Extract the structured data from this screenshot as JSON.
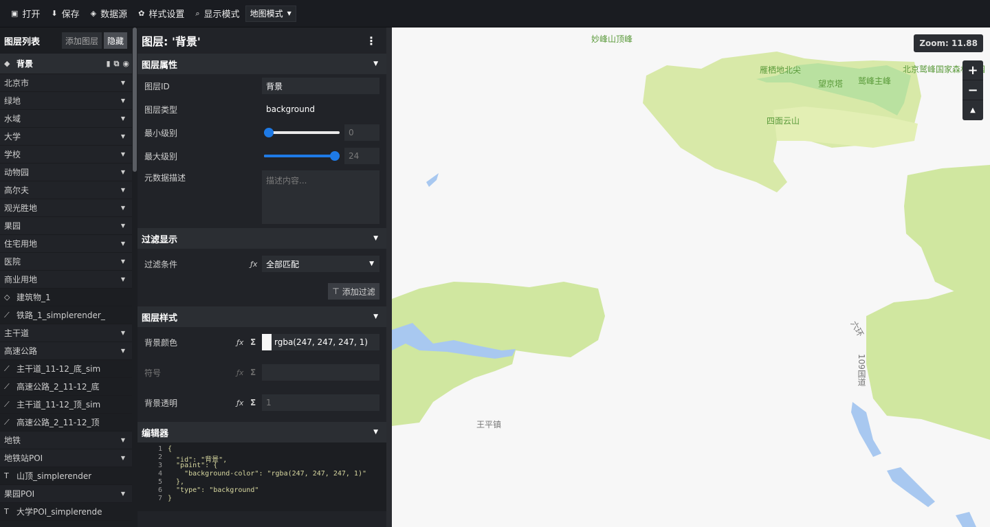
{
  "toolbar": {
    "open": "打开",
    "save": "保存",
    "datasource": "数据源",
    "style_settings": "样式设置",
    "display_mode": "显示模式",
    "mode_value": "地图模式"
  },
  "layer_panel": {
    "title": "图层列表",
    "add_layer": "添加图层",
    "hide": "隐藏",
    "selected": "背景",
    "items": [
      {
        "label": "北京市",
        "kind": "group"
      },
      {
        "label": "绿地",
        "kind": "group"
      },
      {
        "label": "水域",
        "kind": "group"
      },
      {
        "label": "大学",
        "kind": "group"
      },
      {
        "label": "学校",
        "kind": "group"
      },
      {
        "label": "动物园",
        "kind": "group"
      },
      {
        "label": "高尔夫",
        "kind": "group"
      },
      {
        "label": "观光胜地",
        "kind": "group"
      },
      {
        "label": "果园",
        "kind": "group"
      },
      {
        "label": "住宅用地",
        "kind": "group"
      },
      {
        "label": "医院",
        "kind": "group"
      },
      {
        "label": "商业用地",
        "kind": "group"
      },
      {
        "label": "建筑物_1",
        "kind": "fill"
      },
      {
        "label": "铁路_1_simplerender_",
        "kind": "line"
      },
      {
        "label": "主干道",
        "kind": "group"
      },
      {
        "label": "高速公路",
        "kind": "group"
      },
      {
        "label": "主干道_11-12_底_sim",
        "kind": "line"
      },
      {
        "label": "高速公路_2_11-12_底",
        "kind": "line"
      },
      {
        "label": "主干道_11-12_顶_sim",
        "kind": "line"
      },
      {
        "label": "高速公路_2_11-12_顶",
        "kind": "line"
      },
      {
        "label": "地铁",
        "kind": "group"
      },
      {
        "label": "地铁站POI",
        "kind": "group"
      },
      {
        "label": "山顶_simplerender",
        "kind": "symbol"
      },
      {
        "label": "果园POI",
        "kind": "group"
      },
      {
        "label": "大学POI_simplerende",
        "kind": "symbol"
      }
    ]
  },
  "editor_panel": {
    "title": "图层: '背景'",
    "props_section": "图层属性",
    "layer_id_label": "图层ID",
    "layer_id_value": "背景",
    "layer_type_label": "图层类型",
    "layer_type_value": "background",
    "minzoom_label": "最小级别",
    "minzoom_value": "0",
    "minzoom_fraction": 0,
    "maxzoom_label": "最大级别",
    "maxzoom_value": "24",
    "maxzoom_fraction": 1,
    "metadata_label": "元数据描述",
    "metadata_placeholder": "描述内容...",
    "filter_section": "过滤显示",
    "filter_label": "过滤条件",
    "filter_value": "全部匹配",
    "add_filter": "添加过滤",
    "style_section": "图层样式",
    "bg_color_label": "背景颜色",
    "bg_color_value": "rgba(247, 247, 247, 1)",
    "symbol_label": "符号",
    "opacity_label": "背景透明",
    "opacity_value": "1",
    "code_section": "编辑器",
    "code_lines": [
      {
        "n": "1",
        "t": "{"
      },
      {
        "n": "2",
        "t": "  \"id\": \"背景\","
      },
      {
        "n": "3",
        "t": "  \"paint\": {"
      },
      {
        "n": "4",
        "t": "    \"background-color\": \"rgba(247, 247, 247, 1)\""
      },
      {
        "n": "5",
        "t": "  },"
      },
      {
        "n": "6",
        "t": "  \"type\": \"background\""
      },
      {
        "n": "7",
        "t": "}"
      }
    ]
  },
  "map": {
    "zoom_badge": "Zoom: 11.88",
    "labels": {
      "l1": "妙峰山顶峰",
      "l2": "雁栖地北尖",
      "l3": "望京塔",
      "l4": "鹫峰主峰",
      "l5": "北京鹫峰国家森林公园",
      "l6": "四面云山",
      "l7": "王平镇",
      "l8": "六环",
      "l9": "109国道"
    },
    "colors": {
      "background": "#f7f7f7",
      "green": "#cfe6a0",
      "dark_green": "#b8e09a",
      "water": "#a8c8f0"
    }
  }
}
